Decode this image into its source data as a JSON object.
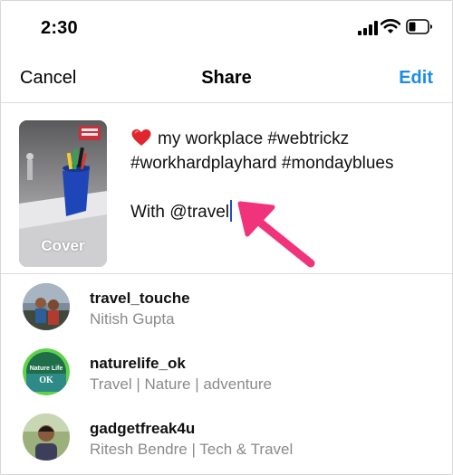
{
  "status_bar": {
    "time": "2:30"
  },
  "nav": {
    "cancel_label": "Cancel",
    "title": "Share",
    "edit_label": "Edit"
  },
  "compose": {
    "cover_label": "Cover",
    "caption_line1": "my workplace #webtrickz",
    "caption_line2": "#workhardplayhard #mondayblues",
    "caption_line3": "With @travel",
    "emoji": "heart-icon"
  },
  "suggestions": [
    {
      "username": "travel_touche",
      "subtitle": "Nitish Gupta"
    },
    {
      "username": "naturelife_ok",
      "subtitle": "Travel | Nature | adventure",
      "avatar_text_1": "Nature Life",
      "avatar_text_2": "OK"
    },
    {
      "username": "gadgetfreak4u",
      "subtitle": "Ritesh Bendre | Tech & Travel"
    }
  ],
  "colors": {
    "accent": "#1a8ce8",
    "annotation_arrow": "#f0337a",
    "caret": "#1f4bd6"
  }
}
